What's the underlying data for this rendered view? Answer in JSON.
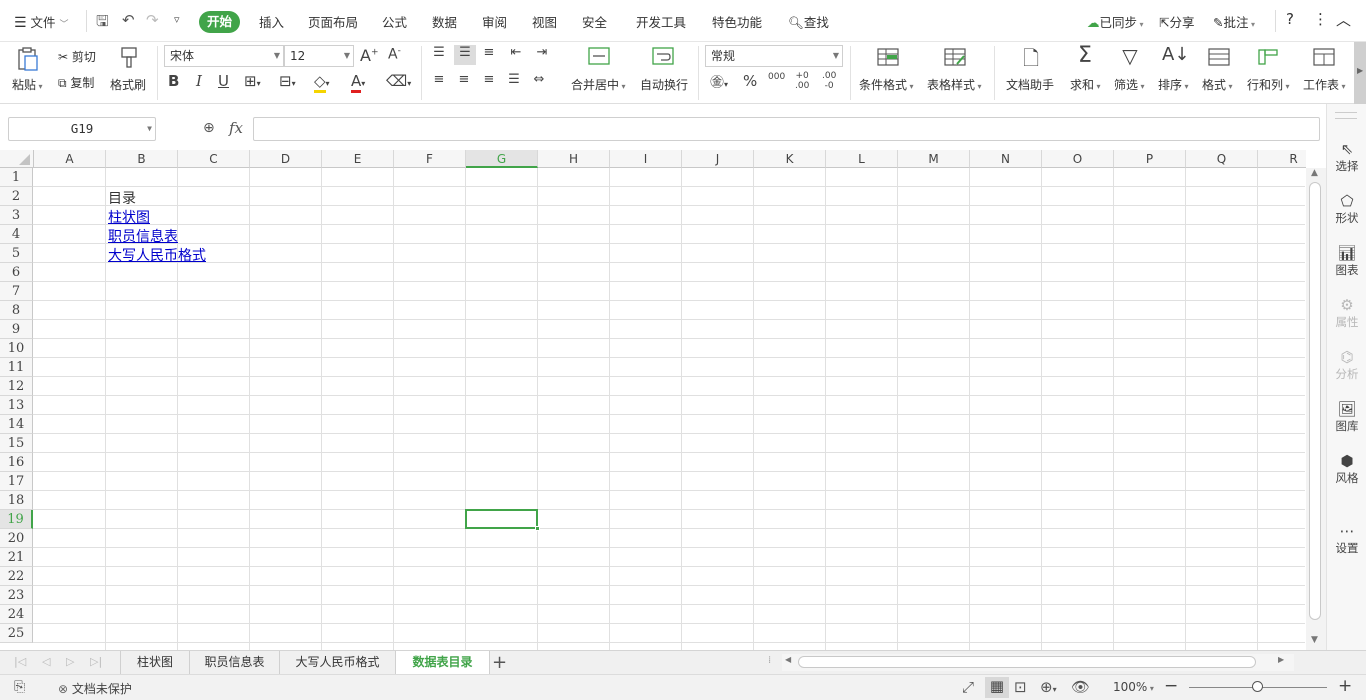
{
  "menu": {
    "file": "文件",
    "tabs": [
      "开始",
      "插入",
      "页面布局",
      "公式",
      "数据",
      "审阅",
      "视图",
      "安全",
      "开发工具",
      "特色功能"
    ],
    "search": "查找",
    "synced": "已同步",
    "share": "分享",
    "comment": "批注",
    "help": "?"
  },
  "ribbon": {
    "paste": "粘贴",
    "cut": "剪切",
    "copy": "复制",
    "format_painter": "格式刷",
    "font_name": "宋体",
    "font_size": "12",
    "merge_center": "合并居中",
    "auto_wrap": "自动换行",
    "number_format": "常规",
    "percent": "%",
    "thousands": "000",
    "conditional_format": "条件格式",
    "table_style": "表格样式",
    "doc_helper": "文档助手",
    "sum": "求和",
    "filter": "筛选",
    "sort": "排序",
    "format": "格式",
    "row_col": "行和列",
    "worksheet": "工作表"
  },
  "formula_bar": {
    "name_box": "G19",
    "fx": "fx",
    "value": ""
  },
  "columns": [
    "A",
    "B",
    "C",
    "D",
    "E",
    "F",
    "G",
    "H",
    "I",
    "J",
    "K",
    "L",
    "M",
    "N",
    "O",
    "P",
    "Q",
    "R"
  ],
  "rows": [
    "1",
    "2",
    "3",
    "4",
    "5",
    "6",
    "7",
    "8",
    "9",
    "10",
    "11",
    "12",
    "13",
    "14",
    "15",
    "16",
    "17",
    "18",
    "19",
    "20",
    "21",
    "22",
    "23",
    "24",
    "25"
  ],
  "cells": {
    "B2": "目录",
    "B3": "柱状图",
    "B4": "职员信息表",
    "B5": "大写人民币格式"
  },
  "selected_cell": "G19",
  "right_panel": [
    {
      "label": "选择",
      "icon": "cursor-icon",
      "disabled": false
    },
    {
      "label": "形状",
      "icon": "shape-icon",
      "disabled": false
    },
    {
      "label": "图表",
      "icon": "chart-icon",
      "disabled": false
    },
    {
      "label": "属性",
      "icon": "property-icon",
      "disabled": true
    },
    {
      "label": "分析",
      "icon": "analysis-icon",
      "disabled": true
    },
    {
      "label": "图库",
      "icon": "gallery-icon",
      "disabled": false
    },
    {
      "label": "风格",
      "icon": "style-icon",
      "disabled": false
    },
    {
      "label": "设置",
      "icon": "settings-icon",
      "disabled": false
    }
  ],
  "sheet_tabs": [
    "柱状图",
    "职员信息表",
    "大写人民币格式",
    "数据表目录"
  ],
  "active_sheet": "数据表目录",
  "status": {
    "protection": "文档未保护",
    "zoom": "100%"
  },
  "colors": {
    "accent": "#41a449",
    "link": "#0000cc"
  }
}
